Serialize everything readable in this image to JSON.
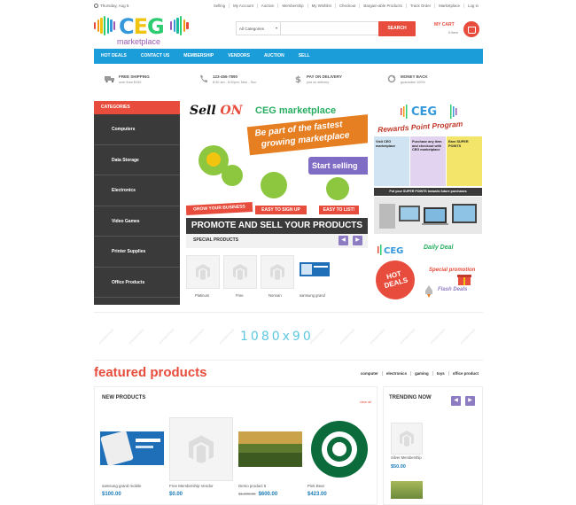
{
  "topbar": {
    "date": "Thursday, Aug 5",
    "links": [
      "Selling",
      "My Account",
      "Auction",
      "Membership",
      "My Wishlist",
      "Checkout",
      "Bargain-able Products",
      "Track Order",
      "Marketplace",
      "Log in"
    ]
  },
  "logo": {
    "letters": "CEG",
    "sub": "marketplace"
  },
  "search": {
    "category": "All Categories",
    "placeholder": "",
    "button": "SEARCH"
  },
  "cart": {
    "label": "MY CART",
    "items": "0 item"
  },
  "nav": [
    "HOT DEALS",
    "CONTACT US",
    "MEMBERSHIP",
    "VENDORS",
    "AUCTION",
    "SELL"
  ],
  "features": [
    {
      "title": "FREE SHIPPING",
      "sub": "over than $150"
    },
    {
      "title": "123-456-7890",
      "sub": "8:30 am - 6:00pm, Mon - Sun"
    },
    {
      "title": "PAY ON DELIVERY",
      "sub": "just on delivery"
    },
    {
      "title": "MONEY BACK",
      "sub": "guarantee 100%"
    }
  ],
  "sidebar": {
    "header": "CATEGORIES",
    "items": [
      "Computers",
      "Data Storage",
      "Electronics",
      "Video Games",
      "Printer Supplies",
      "Office Products"
    ]
  },
  "banner": {
    "sell": "Sell",
    "on": "ON",
    "ceg": "CEG marketplace",
    "ribbon1": "Be part of the fastest",
    "ribbon2": "growing marketplace",
    "start": "Start selling",
    "grow": "GROW YOUR BUSINESS",
    "easy1": "EASY TO SIGN UP",
    "easy2": "EASY TO LIST!",
    "promote": "PROMOTE AND SELL YOUR PRODUCTS"
  },
  "special": {
    "title": "SPECIAL PRODUCTS",
    "items": [
      "Platinum",
      "Free",
      "Nonnan",
      "samsung grand"
    ]
  },
  "rewards": {
    "title": "Rewards Point Program",
    "p1": "Visit CEG marketplace",
    "p2": "Purchase any item and checkout with CEG marketplace",
    "p3": "Earn SUPER POINTS",
    "strip": "Put your SUPER POINTS towards future purchases"
  },
  "deals": {
    "hot": "HOT DEALS",
    "daily": "Daily Deal",
    "promo": "Special promotion",
    "flash": "Flash Deals"
  },
  "ad": {
    "size": "1080x90"
  },
  "featured": {
    "title": "featured products",
    "tabs": [
      "computer",
      "electronics",
      "gaming",
      "toys",
      "office product"
    ]
  },
  "new_products": {
    "title": "NEW PRODUCTS",
    "view_all": "view all",
    "items": [
      {
        "name": "samsung grand mobile",
        "price": "$100.00",
        "old": ""
      },
      {
        "name": "Free Membership Vendor",
        "price": "$0.00",
        "old": ""
      },
      {
        "name": "Demo product 5",
        "price": "$600.00",
        "old": "$1,000.00"
      },
      {
        "name": "Pink Bear",
        "price": "$423.00",
        "old": ""
      }
    ]
  },
  "trending": {
    "title": "TRENDING NOW",
    "items": [
      {
        "name": "Silver Membership",
        "price": "$50.00"
      }
    ]
  },
  "colors": {
    "accent": "#e74c3c",
    "nav": "#1a9dd9",
    "sidebar": "#3a3a3a",
    "purple": "#8e7cc3"
  }
}
